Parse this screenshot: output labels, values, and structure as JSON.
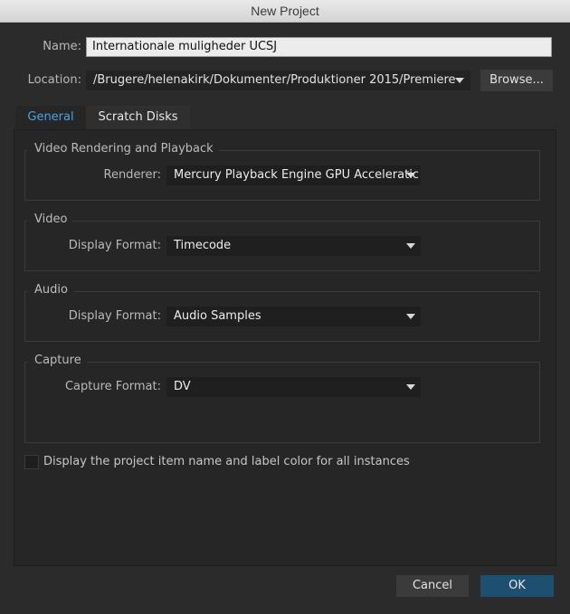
{
  "window": {
    "title": "New Project"
  },
  "name_row": {
    "label": "Name:",
    "value": "Internationale muligheder UCSJ"
  },
  "location_row": {
    "label": "Location:",
    "value": "/Brugere/helenakirk/Dokumenter/Produktioner 2015/Premiere",
    "browse_label": "Browse..."
  },
  "tabs": [
    {
      "label": "General",
      "active": true
    },
    {
      "label": "Scratch Disks",
      "active": false
    }
  ],
  "groups": {
    "rendering": {
      "title": "Video Rendering and Playback",
      "field_label": "Renderer:",
      "value": "Mercury Playback Engine GPU Acceleratic"
    },
    "video": {
      "title": "Video",
      "field_label": "Display Format:",
      "value": "Timecode"
    },
    "audio": {
      "title": "Audio",
      "field_label": "Display Format:",
      "value": "Audio Samples"
    },
    "capture": {
      "title": "Capture",
      "field_label": "Capture Format:",
      "value": "DV"
    }
  },
  "checkbox": {
    "label": "Display the project item name and label color for all instances",
    "checked": false
  },
  "footer": {
    "cancel_label": "Cancel",
    "ok_label": "OK"
  },
  "colors": {
    "accent_tab": "#4aa0e0",
    "ok_button": "#1f4f70",
    "background": "#2b2b2b"
  },
  "icons": {
    "dropdown": "triangle-down-icon"
  }
}
